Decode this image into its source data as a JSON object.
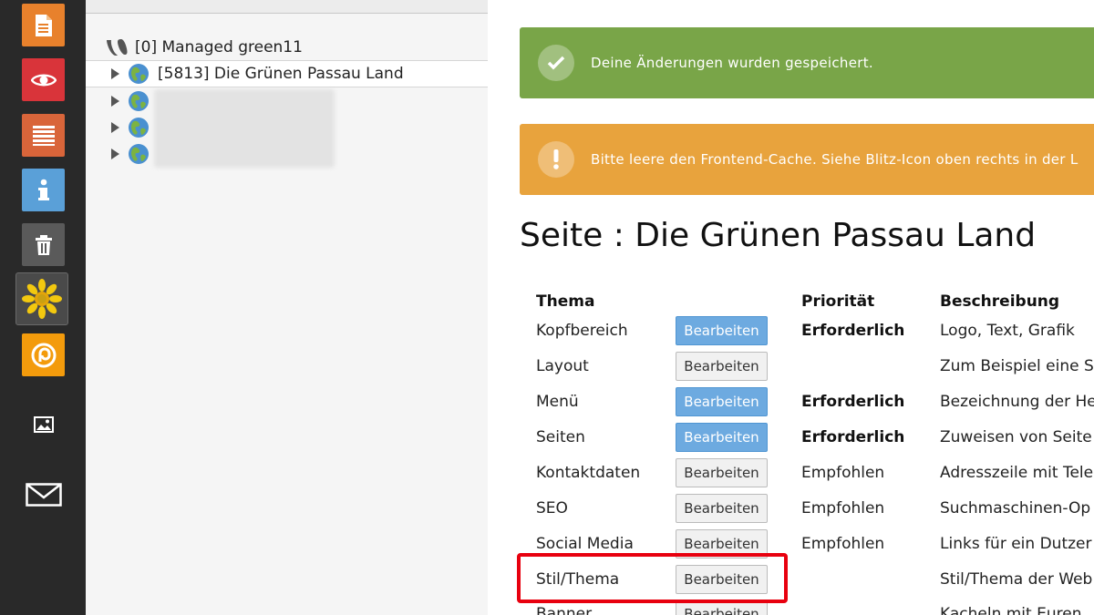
{
  "modules": [
    {
      "name": "page-icon",
      "color": "#e8812c"
    },
    {
      "name": "view-icon",
      "color": "#d9343a"
    },
    {
      "name": "list-icon",
      "color": "#d9653a"
    },
    {
      "name": "info-icon",
      "color": "#5aa0d8"
    },
    {
      "name": "trash-icon",
      "color": "#5a5a5a"
    },
    {
      "name": "sunflower-icon",
      "color": "#f2c80f"
    },
    {
      "name": "at-icon",
      "color": "#f39b0c"
    },
    {
      "name": "image-icon",
      "color": "#ffffff"
    },
    {
      "name": "mail-icon",
      "color": "#ffffff"
    }
  ],
  "tree": {
    "root_label": "[0] Managed green11",
    "selected_label": "[5813] Die Grünen Passau Land"
  },
  "alerts": {
    "success": "Deine Änderungen wurden gespeichert.",
    "warning": "Bitte leere den Frontend-Cache. Siehe Blitz-Icon oben rechts in der L"
  },
  "heading": "Seite : Die Grünen Passau Land",
  "table": {
    "headers": {
      "thema": "Thema",
      "prioritaet": "Priorität",
      "beschreibung": "Beschreibung"
    },
    "button_label": "Bearbeiten",
    "rows": [
      {
        "thema": "Kopfbereich",
        "prioritaet": "Erforderlich",
        "beschreibung": "Logo, Text, Grafik",
        "style": "primary"
      },
      {
        "thema": "Layout",
        "prioritaet": "",
        "beschreibung": "Zum Beispiel eine S",
        "style": "default"
      },
      {
        "thema": "Menü",
        "prioritaet": "Erforderlich",
        "beschreibung": "Bezeichnung der He",
        "style": "primary"
      },
      {
        "thema": "Seiten",
        "prioritaet": "Erforderlich",
        "beschreibung": "Zuweisen von Seite",
        "style": "primary"
      },
      {
        "thema": "Kontaktdaten",
        "prioritaet": "Empfohlen",
        "beschreibung": "Adresszeile mit Tele",
        "style": "default"
      },
      {
        "thema": "SEO",
        "prioritaet": "Empfohlen",
        "beschreibung": "Suchmaschinen-Op",
        "style": "default"
      },
      {
        "thema": "Social Media",
        "prioritaet": "Empfohlen",
        "beschreibung": "Links für ein Dutzer",
        "style": "default"
      },
      {
        "thema": "Stil/Thema",
        "prioritaet": "",
        "beschreibung": "Stil/Thema der Web",
        "style": "default"
      },
      {
        "thema": "Banner",
        "prioritaet": "",
        "beschreibung": "Kacheln mit Euren",
        "style": "default"
      }
    ]
  }
}
